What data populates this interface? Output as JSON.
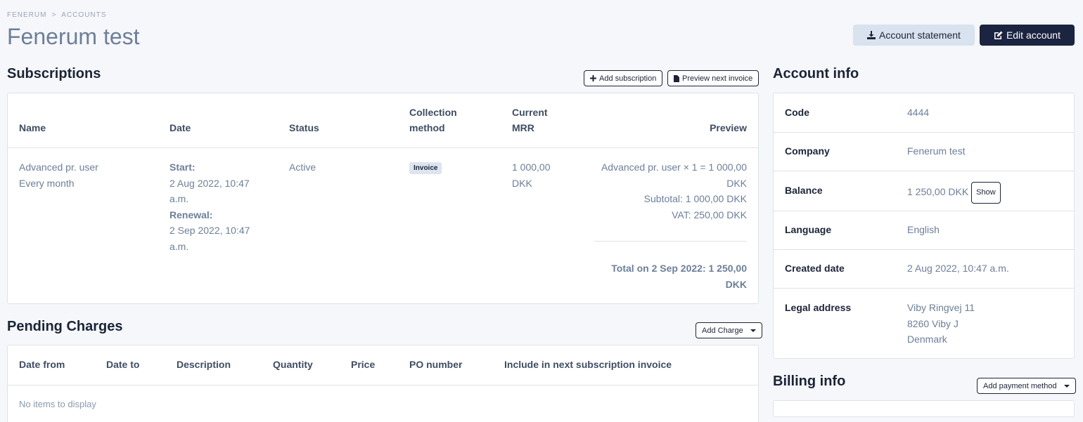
{
  "breadcrumb": {
    "items": [
      "FENERUM",
      "ACCOUNTS"
    ],
    "separator": ">"
  },
  "page": {
    "title": "Fenerum test"
  },
  "header": {
    "account_statement_label": "Account statement",
    "edit_account_label": "Edit account"
  },
  "subscriptions": {
    "title": "Subscriptions",
    "add_label": "Add subscription",
    "preview_label": "Preview next invoice",
    "columns": [
      "Name",
      "Date",
      "Status",
      "Collection method",
      "Current MRR",
      "Preview"
    ],
    "columns_split": {
      "collection": [
        "Collection",
        "method"
      ],
      "mrr": [
        "Current",
        "MRR"
      ]
    },
    "row": {
      "name": "Advanced pr. user",
      "interval": "Every month",
      "start_label": "Start:",
      "start_value_1": "2 Aug 2022, 10:47",
      "start_value_2": "a.m.",
      "renewal_label": "Renewal:",
      "renewal_value_1": "2 Sep 2022, 10:47",
      "renewal_value_2": "a.m.",
      "status": "Active",
      "collection_method": "Invoice",
      "mrr_1": "1 000,00",
      "mrr_2": "DKK",
      "preview_line_1": "Advanced pr. user × 1 = 1 000,00",
      "preview_line_2": "DKK",
      "subtotal": "Subtotal: 1 000,00 DKK",
      "vat": "VAT: 250,00 DKK",
      "total_1": "Total on 2 Sep 2022: 1 250,00",
      "total_2": "DKK"
    }
  },
  "pending": {
    "title": "Pending Charges",
    "add_label": "Add Charge",
    "columns": [
      "Date from",
      "Date to",
      "Description",
      "Quantity",
      "Price",
      "PO number",
      "Include in next subscription invoice"
    ],
    "empty_text": "No items to display"
  },
  "account_info": {
    "title": "Account info",
    "rows": [
      {
        "label": "Code",
        "value": "4444"
      },
      {
        "label": "Company",
        "value": "Fenerum test"
      },
      {
        "label": "Balance",
        "value": "1 250,00 DKK",
        "action": "Show"
      },
      {
        "label": "Language",
        "value": "English"
      },
      {
        "label": "Created date",
        "value": "2 Aug 2022, 10:47 a.m."
      },
      {
        "label": "Legal address",
        "lines": [
          "Viby Ringvej 11",
          "8260 Viby J",
          "Denmark"
        ]
      }
    ]
  },
  "billing": {
    "title": "Billing info",
    "add_label": "Add payment method"
  },
  "icons": {
    "download": "download-icon",
    "edit": "edit-icon",
    "plus": "plus-icon",
    "file": "file-icon",
    "caret": "caret-down-icon"
  }
}
